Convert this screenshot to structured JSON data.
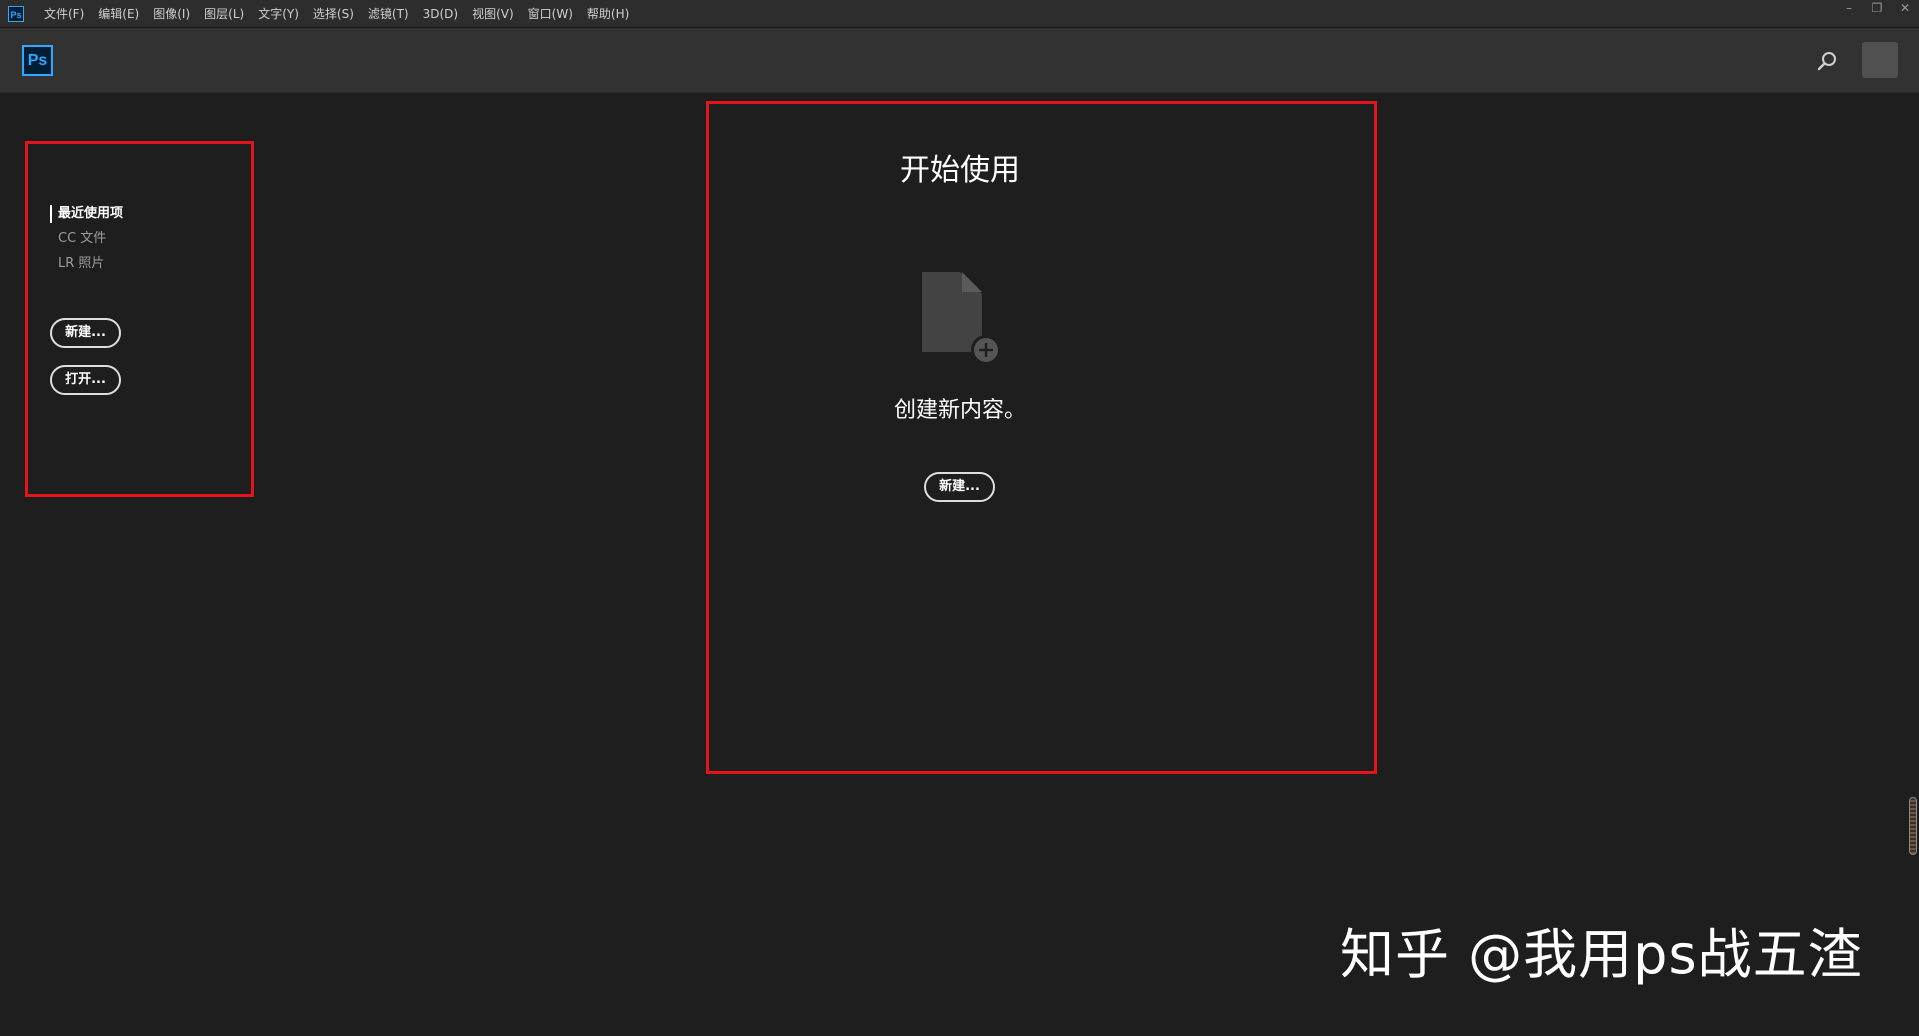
{
  "menubar": {
    "app_icon": "Ps",
    "items": [
      {
        "label": "文件(F)"
      },
      {
        "label": "编辑(E)"
      },
      {
        "label": "图像(I)"
      },
      {
        "label": "图层(L)"
      },
      {
        "label": "文字(Y)"
      },
      {
        "label": "选择(S)"
      },
      {
        "label": "滤镜(T)"
      },
      {
        "label": "3D(D)"
      },
      {
        "label": "视图(V)"
      },
      {
        "label": "窗口(W)"
      },
      {
        "label": "帮助(H)"
      }
    ],
    "window_controls": {
      "minimize": "–",
      "restore": "❐",
      "close": "✕"
    }
  },
  "header": {
    "logo": "Ps",
    "icons": {
      "search": "search-icon",
      "avatar": "avatar"
    }
  },
  "sidebar": {
    "items": [
      {
        "label": "最近使用项",
        "active": true
      },
      {
        "label": "CC 文件",
        "active": false
      },
      {
        "label": "LR 照片",
        "active": false
      }
    ],
    "new_button": "新建...",
    "open_button": "打开..."
  },
  "main": {
    "title": "开始使用",
    "icon": "new-document-icon",
    "message": "创建新内容。",
    "new_button": "新建..."
  },
  "watermark": "知乎 @我用ps战五渣",
  "colors": {
    "background": "#1e1e1e",
    "menubar": "#2d2d2d",
    "header": "#323232",
    "ps_blue": "#31a8ff",
    "annotation_red": "#e3151b"
  }
}
